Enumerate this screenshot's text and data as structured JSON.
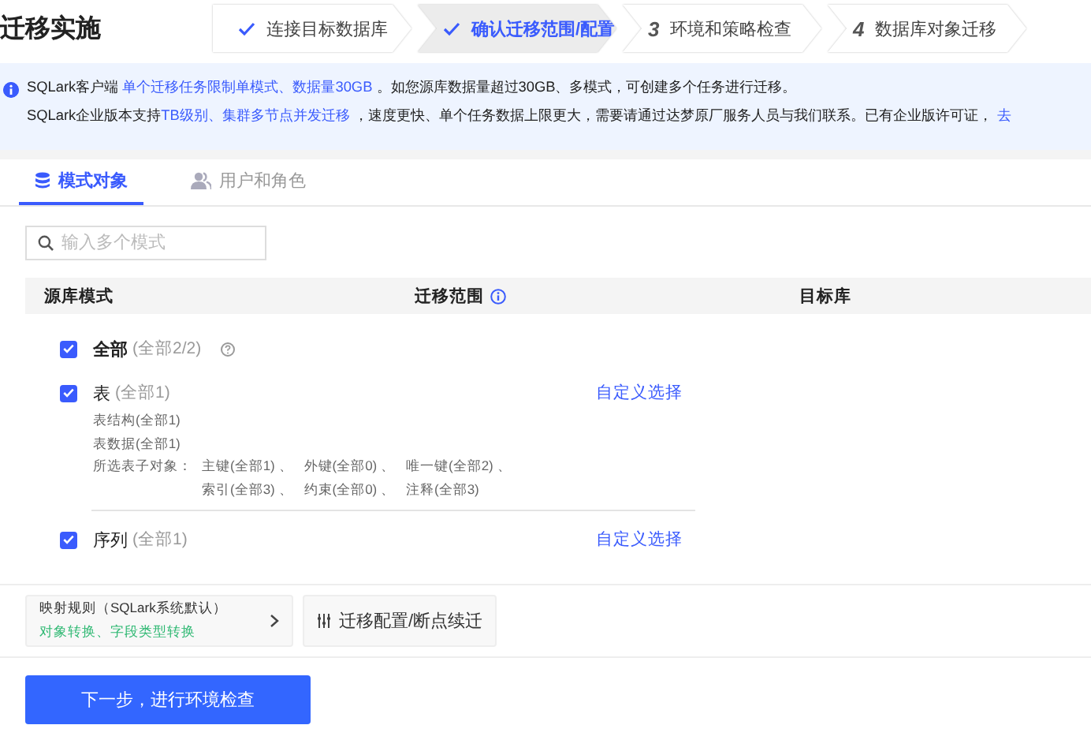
{
  "title": "迁移实施",
  "steps": [
    {
      "label": "连接目标数据库",
      "done": true,
      "selected": false
    },
    {
      "label": "确认迁移范围/配置",
      "done": true,
      "selected": true
    },
    {
      "number": "3",
      "label": "环境和策略检查",
      "done": false,
      "selected": false
    },
    {
      "number": "4",
      "label": "数据库对象迁移",
      "done": false,
      "selected": false
    }
  ],
  "notice": {
    "lines": [
      "SQLark客户端 **单个迁移任务限制单模式、数据量30GB** 。如您源库数据量超过30GB、多模式，可创建多个任务进行迁移。",
      "SQLark企业版本支持**TB级别、集群多节点并发迁移** ，速度更快、单个任务数据上限更大，需要请通过达梦原厂服务人员与我们联系。已有企业版许可证，"
    ],
    "link": "去"
  },
  "tabs": [
    {
      "label": "模式对象",
      "kind": "database",
      "selected": true
    },
    {
      "label": "用户和角色",
      "kind": "users",
      "selected": false
    }
  ],
  "search": {
    "placeholder": "输入多个模式"
  },
  "columns": [
    {
      "label": "源库模式",
      "info": false
    },
    {
      "label": "迁移范围",
      "info": true
    },
    {
      "label": "目标库",
      "info": false
    }
  ],
  "all": {
    "label": "全部",
    "count": "(全部2/2)",
    "checked": true
  },
  "groups": [
    {
      "label": "表",
      "count": "(全部1)",
      "checked": true,
      "action": "自定义选择",
      "details": [
        "表结构(全部1)",
        "表数据(全部1)"
      ],
      "subobjects_label": "所选表子对象：",
      "subobjects": [
        "主键(全部1) 、",
        "外键(全部0) 、",
        "唯一键(全部2) 、",
        "索引(全部3) 、",
        "约束(全部0) 、",
        "注释(全部3)"
      ]
    },
    {
      "label": "序列",
      "count": "(全部1)",
      "checked": true,
      "action": "自定义选择"
    }
  ],
  "mapping": {
    "title": "映射规则（SQLark系统默认）",
    "subtitle": "对象转换、字段类型转换"
  },
  "config_button": "迁移配置/断点续迁",
  "next_button": "下一步，进行环境检查"
}
